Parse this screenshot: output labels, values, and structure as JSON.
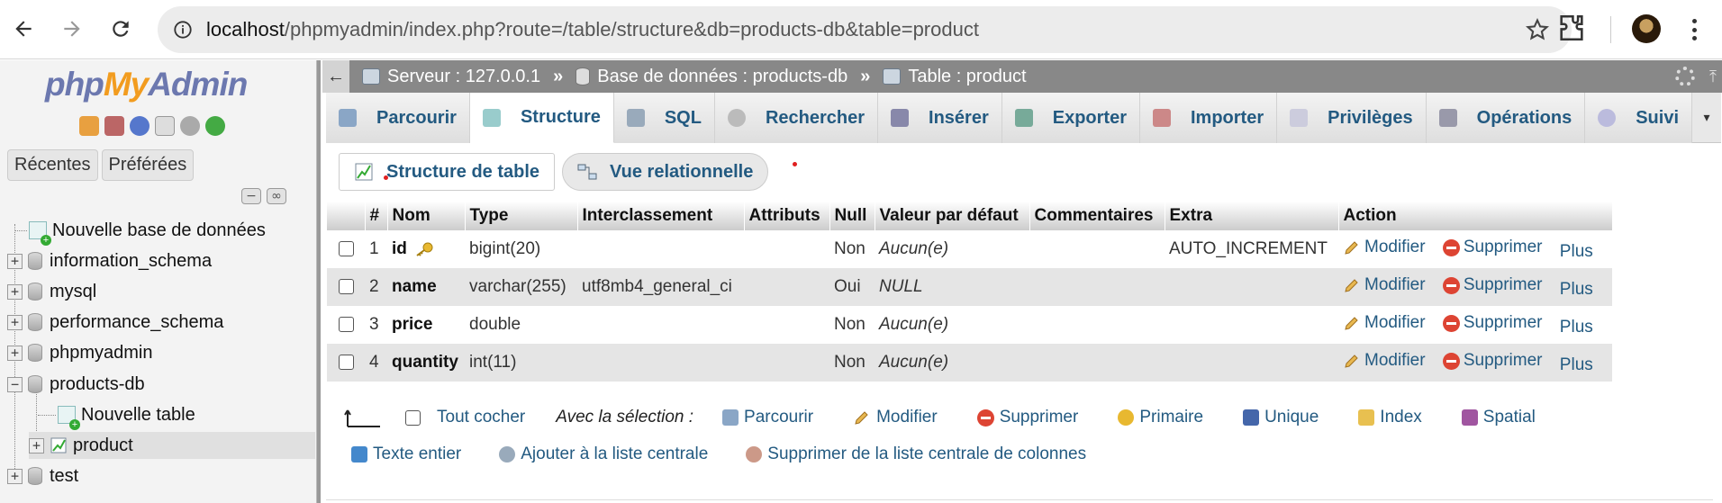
{
  "browser": {
    "url_host": "localhost",
    "url_path": "/phpmyadmin/index.php?route=/table/structure&db=products-db&table=product"
  },
  "nav": {
    "logo": {
      "php": "php",
      "my": "My",
      "admin": "Admin"
    },
    "recent_tab": "Récentes",
    "favorites_tab": "Préférées",
    "tree": [
      {
        "label": "Nouvelle base de données",
        "kind": "new"
      },
      {
        "label": "information_schema",
        "kind": "db"
      },
      {
        "label": "mysql",
        "kind": "db"
      },
      {
        "label": "performance_schema",
        "kind": "db"
      },
      {
        "label": "phpmyadmin",
        "kind": "db"
      },
      {
        "label": "products-db",
        "kind": "db-open"
      },
      {
        "label": "Nouvelle table",
        "kind": "new-child"
      },
      {
        "label": "product",
        "kind": "table-child"
      },
      {
        "label": "test",
        "kind": "db"
      }
    ]
  },
  "breadcrumb": {
    "server": "Serveur : 127.0.0.1",
    "database": "Base de données : products-db",
    "table": "Table : product",
    "sep": "»"
  },
  "tabs": [
    {
      "label": "Parcourir",
      "icon": "browse-icon"
    },
    {
      "label": "Structure",
      "icon": "structure-icon",
      "active": true
    },
    {
      "label": "SQL",
      "icon": "sql-icon"
    },
    {
      "label": "Rechercher",
      "icon": "search-icon"
    },
    {
      "label": "Insérer",
      "icon": "insert-icon"
    },
    {
      "label": "Exporter",
      "icon": "export-icon"
    },
    {
      "label": "Importer",
      "icon": "import-icon"
    },
    {
      "label": "Privilèges",
      "icon": "privileges-icon"
    },
    {
      "label": "Opérations",
      "icon": "operations-icon"
    },
    {
      "label": "Suivi",
      "icon": "tracking-icon"
    }
  ],
  "subtabs": {
    "table_structure": "Structure de table",
    "relation_view": "Vue relationnelle"
  },
  "table": {
    "headers": [
      "#",
      "Nom",
      "Type",
      "Interclassement",
      "Attributs",
      "Null",
      "Valeur par défaut",
      "Commentaires",
      "Extra",
      "Action"
    ],
    "rows": [
      {
        "num": "1",
        "name": "id",
        "type": "bigint(20)",
        "collation": "",
        "attributes": "",
        "null": "Non",
        "default": "Aucun(e)",
        "comments": "",
        "extra": "AUTO_INCREMENT",
        "primary": true
      },
      {
        "num": "2",
        "name": "name",
        "type": "varchar(255)",
        "collation": "utf8mb4_general_ci",
        "attributes": "",
        "null": "Oui",
        "default": "NULL",
        "comments": "",
        "extra": ""
      },
      {
        "num": "3",
        "name": "price",
        "type": "double",
        "collation": "",
        "attributes": "",
        "null": "Non",
        "default": "Aucun(e)",
        "comments": "",
        "extra": ""
      },
      {
        "num": "4",
        "name": "quantity",
        "type": "int(11)",
        "collation": "",
        "attributes": "",
        "null": "Non",
        "default": "Aucun(e)",
        "comments": "",
        "extra": ""
      }
    ],
    "actions": {
      "edit": "Modifier",
      "drop": "Supprimer",
      "more": "Plus"
    }
  },
  "bulk": {
    "check_all": "Tout cocher",
    "with_selected": "Avec la sélection :",
    "browse": "Parcourir",
    "edit": "Modifier",
    "drop": "Supprimer",
    "primary": "Primaire",
    "unique": "Unique",
    "index": "Index",
    "spatial": "Spatial",
    "fulltext": "Texte entier",
    "add_central": "Ajouter à la liste centrale",
    "remove_central": "Supprimer de la liste centrale de colonnes"
  }
}
